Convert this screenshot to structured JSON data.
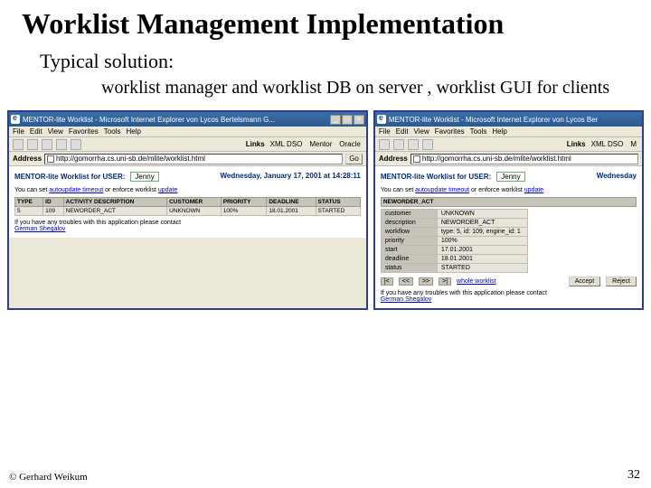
{
  "slide": {
    "title": "Worklist Management Implementation",
    "subtitle": "Typical solution:",
    "body": "worklist manager and worklist DB on server , worklist GUI for clients",
    "copyright": "© Gerhard Weikum",
    "page_number": "32"
  },
  "left": {
    "window_title": "MENTOR-lite Worklist - Microsoft Internet Explorer von Lycos Bertelsmann G...",
    "min": "_",
    "max": "□",
    "close": "×",
    "menu": [
      "File",
      "Edit",
      "View",
      "Favorites",
      "Tools",
      "Help"
    ],
    "links_label": "Links",
    "link_chips": [
      "XML DSO",
      "Mentor",
      "Oracle"
    ],
    "address_label": "Address",
    "address_url": "http://gomorrha.cs.uni-sb.de/mlite/worklist.html",
    "go": "Go",
    "page_title": "MENTOR-lite Worklist for USER:",
    "user": "Jenny",
    "datetime": "Wednesday, January 17, 2001 at 14:28:11",
    "blurb_pre": "You can set ",
    "blurb_link1": "autoupdate timeout",
    "blurb_mid": " or enforce worklist ",
    "blurb_link2": "update",
    "table_headers": [
      "TYPE",
      "ID",
      "ACTIVITY DESCRIPTION",
      "CUSTOMER",
      "PRIORITY",
      "DEADLINE",
      "STATUS"
    ],
    "row": [
      "5",
      "109",
      "NEWORDER_ACT",
      "UNKNOWN",
      "100%",
      "18.01.2001",
      "STARTED"
    ],
    "trouble_pre": "If you have any troubles with this application please contact ",
    "trouble_link": "German Shegalov"
  },
  "right": {
    "window_title": "MENTOR-lite Worklist - Microsoft Internet Explorer von Lycos Ber",
    "menu": [
      "File",
      "Edit",
      "View",
      "Favorites",
      "Tools",
      "Help"
    ],
    "links_label": "Links",
    "link_chips": [
      "XML DSO",
      "M"
    ],
    "address_label": "Address",
    "address_url": "http://gomorrha.cs.uni-sb.de/mlite/worklist.html",
    "page_title": "MENTOR-lite Worklist for USER:",
    "user": "Jenny",
    "date": "Wednesday",
    "blurb_pre": "You can set ",
    "blurb_link1": "autoupdate timeout",
    "blurb_mid": " or enforce worklist ",
    "blurb_link2": "update",
    "act_header": "NEWORDER_ACT",
    "details": [
      [
        "customer",
        "UNKNOWN"
      ],
      [
        "description",
        "NEWORDER_ACT"
      ],
      [
        "workflow",
        "type: 5, id: 109, engine_id: 1"
      ],
      [
        "priority",
        "100%"
      ],
      [
        "start",
        "17.01.2001"
      ],
      [
        "deadline",
        "18.01.2001"
      ],
      [
        "status",
        "STARTED"
      ]
    ],
    "nav": [
      "|<",
      "<<",
      ">>",
      ">|"
    ],
    "whole_link": "whole worklist",
    "accept": "Accept",
    "reject": "Reject",
    "trouble_pre": "If you have any troubles with this application please contact ",
    "trouble_link": "German Shegalov"
  }
}
